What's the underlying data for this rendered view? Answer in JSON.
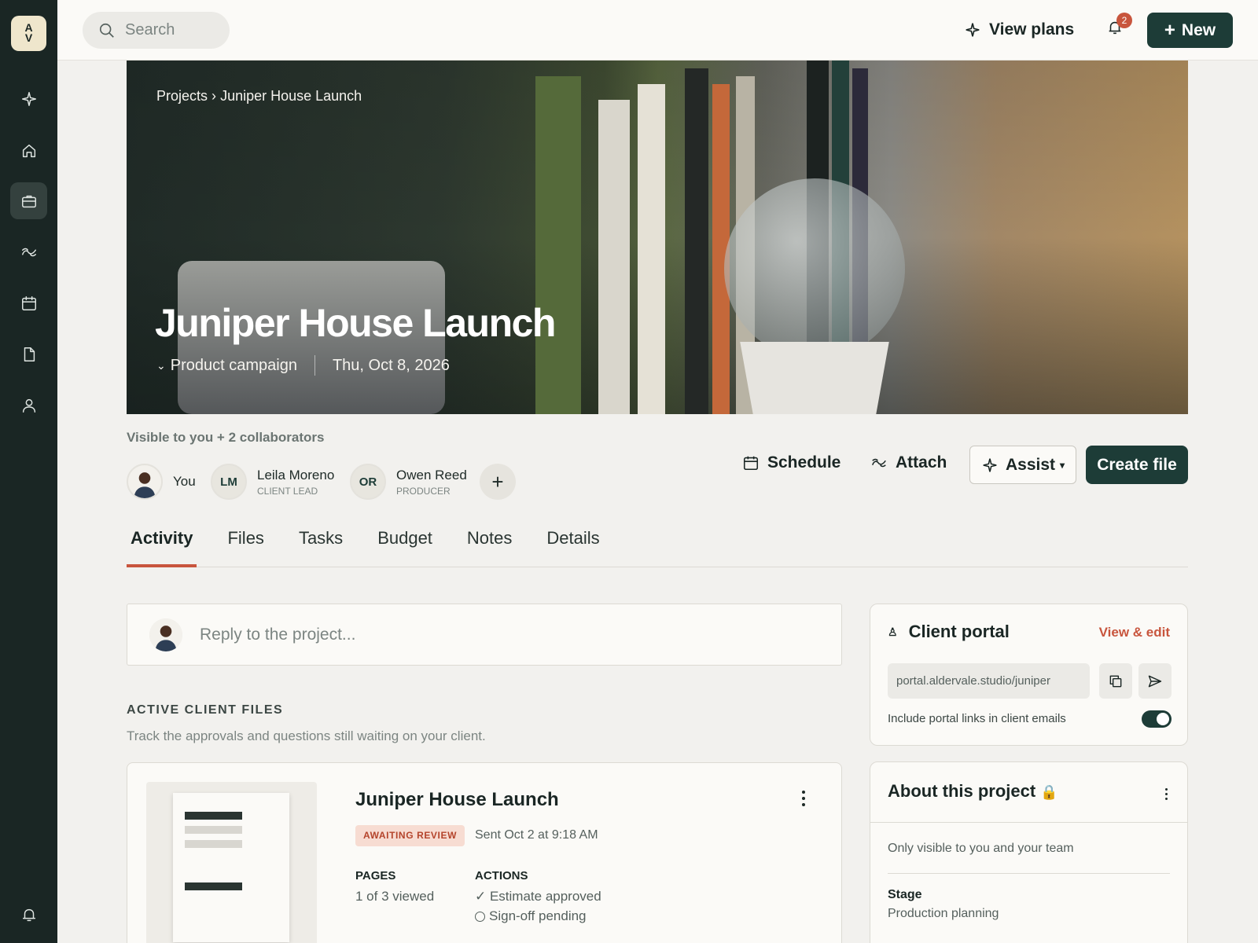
{
  "brand": {
    "logo_top": "A",
    "logo_bottom": "V"
  },
  "sidebar": {
    "items": [
      {
        "name": "sparkle",
        "active": false
      },
      {
        "name": "home",
        "active": false
      },
      {
        "name": "briefcase",
        "active": true
      },
      {
        "name": "link",
        "active": false
      },
      {
        "name": "calendar",
        "active": false
      },
      {
        "name": "document",
        "active": false
      },
      {
        "name": "person",
        "active": false
      }
    ],
    "bottom_icon": "bell"
  },
  "topbar": {
    "search_placeholder": "Search",
    "view_plans_label": "View plans",
    "notification_count": "2",
    "new_label": "New"
  },
  "hero": {
    "breadcrumb_parent": "Projects",
    "breadcrumb_sep": "›",
    "breadcrumb_current": "Juniper House Launch",
    "title": "Juniper House Launch",
    "type_label": "Product campaign",
    "date": "Thu, Oct 8, 2026"
  },
  "collaborators": {
    "visible_label": "Visible to you + 2 collaborators",
    "people": [
      {
        "initials": "",
        "name": "You",
        "role": ""
      },
      {
        "initials": "LM",
        "name": "Leila Moreno",
        "role": "CLIENT LEAD"
      },
      {
        "initials": "OR",
        "name": "Owen Reed",
        "role": "PRODUCER"
      }
    ],
    "add_label": "+"
  },
  "actions": {
    "schedule": "Schedule",
    "attach": "Attach",
    "assist": "Assist",
    "create_file": "Create file"
  },
  "tabs": [
    {
      "label": "Activity",
      "active": true
    },
    {
      "label": "Files",
      "active": false
    },
    {
      "label": "Tasks",
      "active": false
    },
    {
      "label": "Budget",
      "active": false
    },
    {
      "label": "Notes",
      "active": false
    },
    {
      "label": "Details",
      "active": false
    }
  ],
  "reply": {
    "placeholder": "Reply to the project..."
  },
  "active_files": {
    "heading": "ACTIVE CLIENT FILES",
    "subtitle": "Track the approvals and questions still waiting on your client.",
    "file": {
      "title": "Juniper House Launch",
      "status": "AWAITING REVIEW",
      "sent": "Sent Oct 2 at 9:18 AM",
      "pages_label": "PAGES",
      "pages_value": "1 of 3 viewed",
      "actions_label": "ACTIONS",
      "action_1": "✓ Estimate approved",
      "action_2": "Sign-off pending"
    }
  },
  "client_portal": {
    "title": "Client portal",
    "edit_label": "View & edit",
    "url": "portal.aldervale.studio/juniper",
    "toggle_label": "Include portal links in client emails",
    "toggle_on": true
  },
  "about": {
    "title": "About this project",
    "subtitle": "Only visible to you and your team",
    "stage_label": "Stage",
    "stage_value": "Production planning"
  },
  "colors": {
    "sidebar": "#1a2624",
    "primary": "#1d3c37",
    "accent": "#c8553d",
    "background": "#f2f1ee"
  }
}
